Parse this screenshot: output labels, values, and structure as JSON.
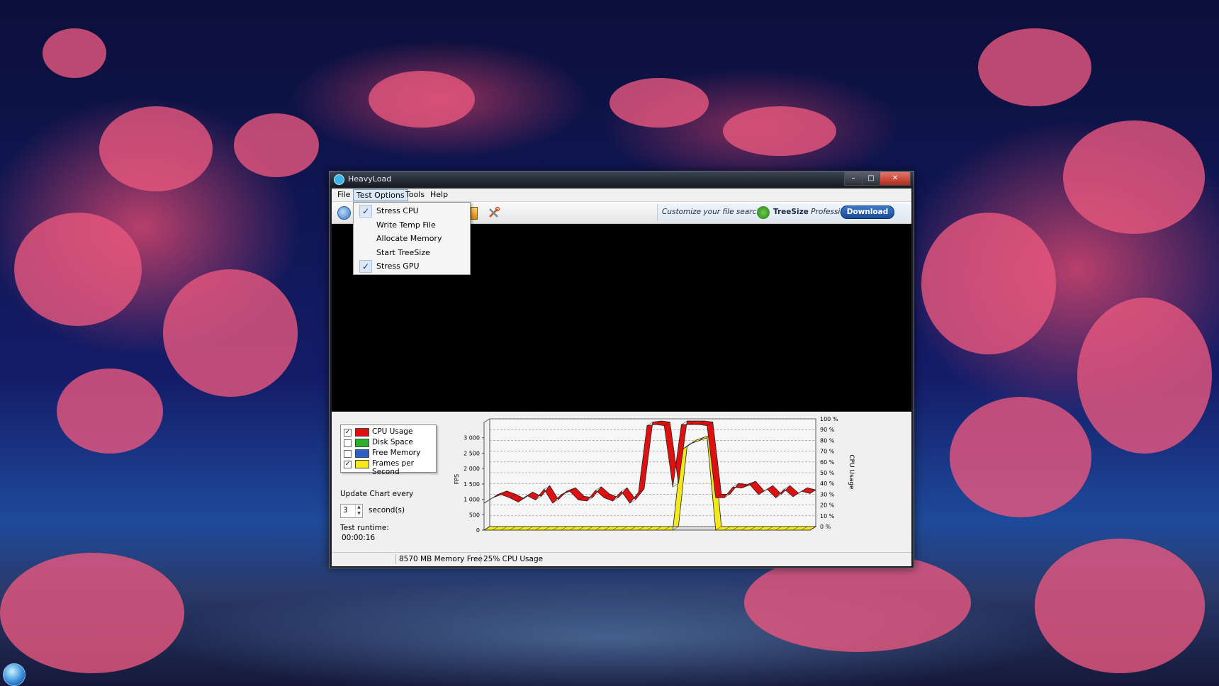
{
  "window": {
    "title": "HeavyLoad",
    "controls": {
      "minimize": "–",
      "maximize": "□",
      "close": "✕"
    }
  },
  "menu": {
    "file": "File",
    "test_options": "Test Options",
    "tools": "Tools",
    "help": "Help"
  },
  "test_options_menu": {
    "items": [
      {
        "label": "Stress CPU",
        "checked": true
      },
      {
        "label": "Write Temp File",
        "checked": false
      },
      {
        "label": "Allocate Memory",
        "checked": false
      },
      {
        "label": "Start TreeSize",
        "checked": false
      },
      {
        "label": "Stress GPU",
        "checked": true
      }
    ],
    "check_glyph": "✓"
  },
  "ad": {
    "text": "Customize your file search",
    "brand": "TreeSize",
    "edition": "Professional",
    "button": "Download"
  },
  "legend": {
    "items": [
      {
        "label": "CPU Usage",
        "checked": true,
        "color": "#e01010"
      },
      {
        "label": "Disk Space",
        "checked": false,
        "color": "#2cb02c"
      },
      {
        "label": "Free Memory",
        "checked": false,
        "color": "#2a62c8"
      },
      {
        "label": "Frames per Second",
        "checked": true,
        "color": "#f2e81a"
      }
    ]
  },
  "controls_panel": {
    "update_label": "Update Chart every",
    "interval": "3",
    "unit": "second(s)",
    "runtime_label": "Test runtime:",
    "runtime": "00:00:16"
  },
  "chart_data": {
    "type": "area",
    "left_axis_label": "FPS",
    "right_axis_label": "CPU Usage",
    "left_ticks": [
      "0",
      "500",
      "1 000",
      "1 500",
      "2 000",
      "2 500",
      "3 000"
    ],
    "right_ticks": [
      "0 %",
      "10 %",
      "20 %",
      "30 %",
      "40 %",
      "50 %",
      "60 %",
      "70 %",
      "80 %",
      "90 %",
      "100 %"
    ],
    "ylim_fps": [
      0,
      3500
    ],
    "ylim_cpu": [
      0,
      100
    ],
    "series": [
      {
        "name": "CPU Usage",
        "color": "#e01010",
        "values": [
          25,
          30,
          33,
          30,
          26,
          32,
          28,
          38,
          25,
          33,
          36,
          28,
          27,
          37,
          30,
          27,
          36,
          25,
          35,
          97,
          98,
          97,
          40,
          98,
          98,
          98,
          97,
          30,
          30,
          40,
          39,
          42,
          33,
          38,
          30,
          38,
          31,
          36,
          34
        ]
      },
      {
        "name": "Frames per Second",
        "color": "#f2e81a",
        "values": [
          0,
          0,
          0,
          0,
          0,
          0,
          0,
          0,
          0,
          0,
          0,
          0,
          0,
          0,
          0,
          0,
          0,
          0,
          0,
          0,
          0,
          0,
          0,
          2600,
          2800,
          2900,
          3000,
          0,
          0,
          0,
          0,
          0,
          0,
          0,
          0,
          0,
          0,
          0,
          0
        ]
      }
    ]
  },
  "status": {
    "memory": "8570 MB Memory Free",
    "cpu": "25% CPU Usage"
  }
}
